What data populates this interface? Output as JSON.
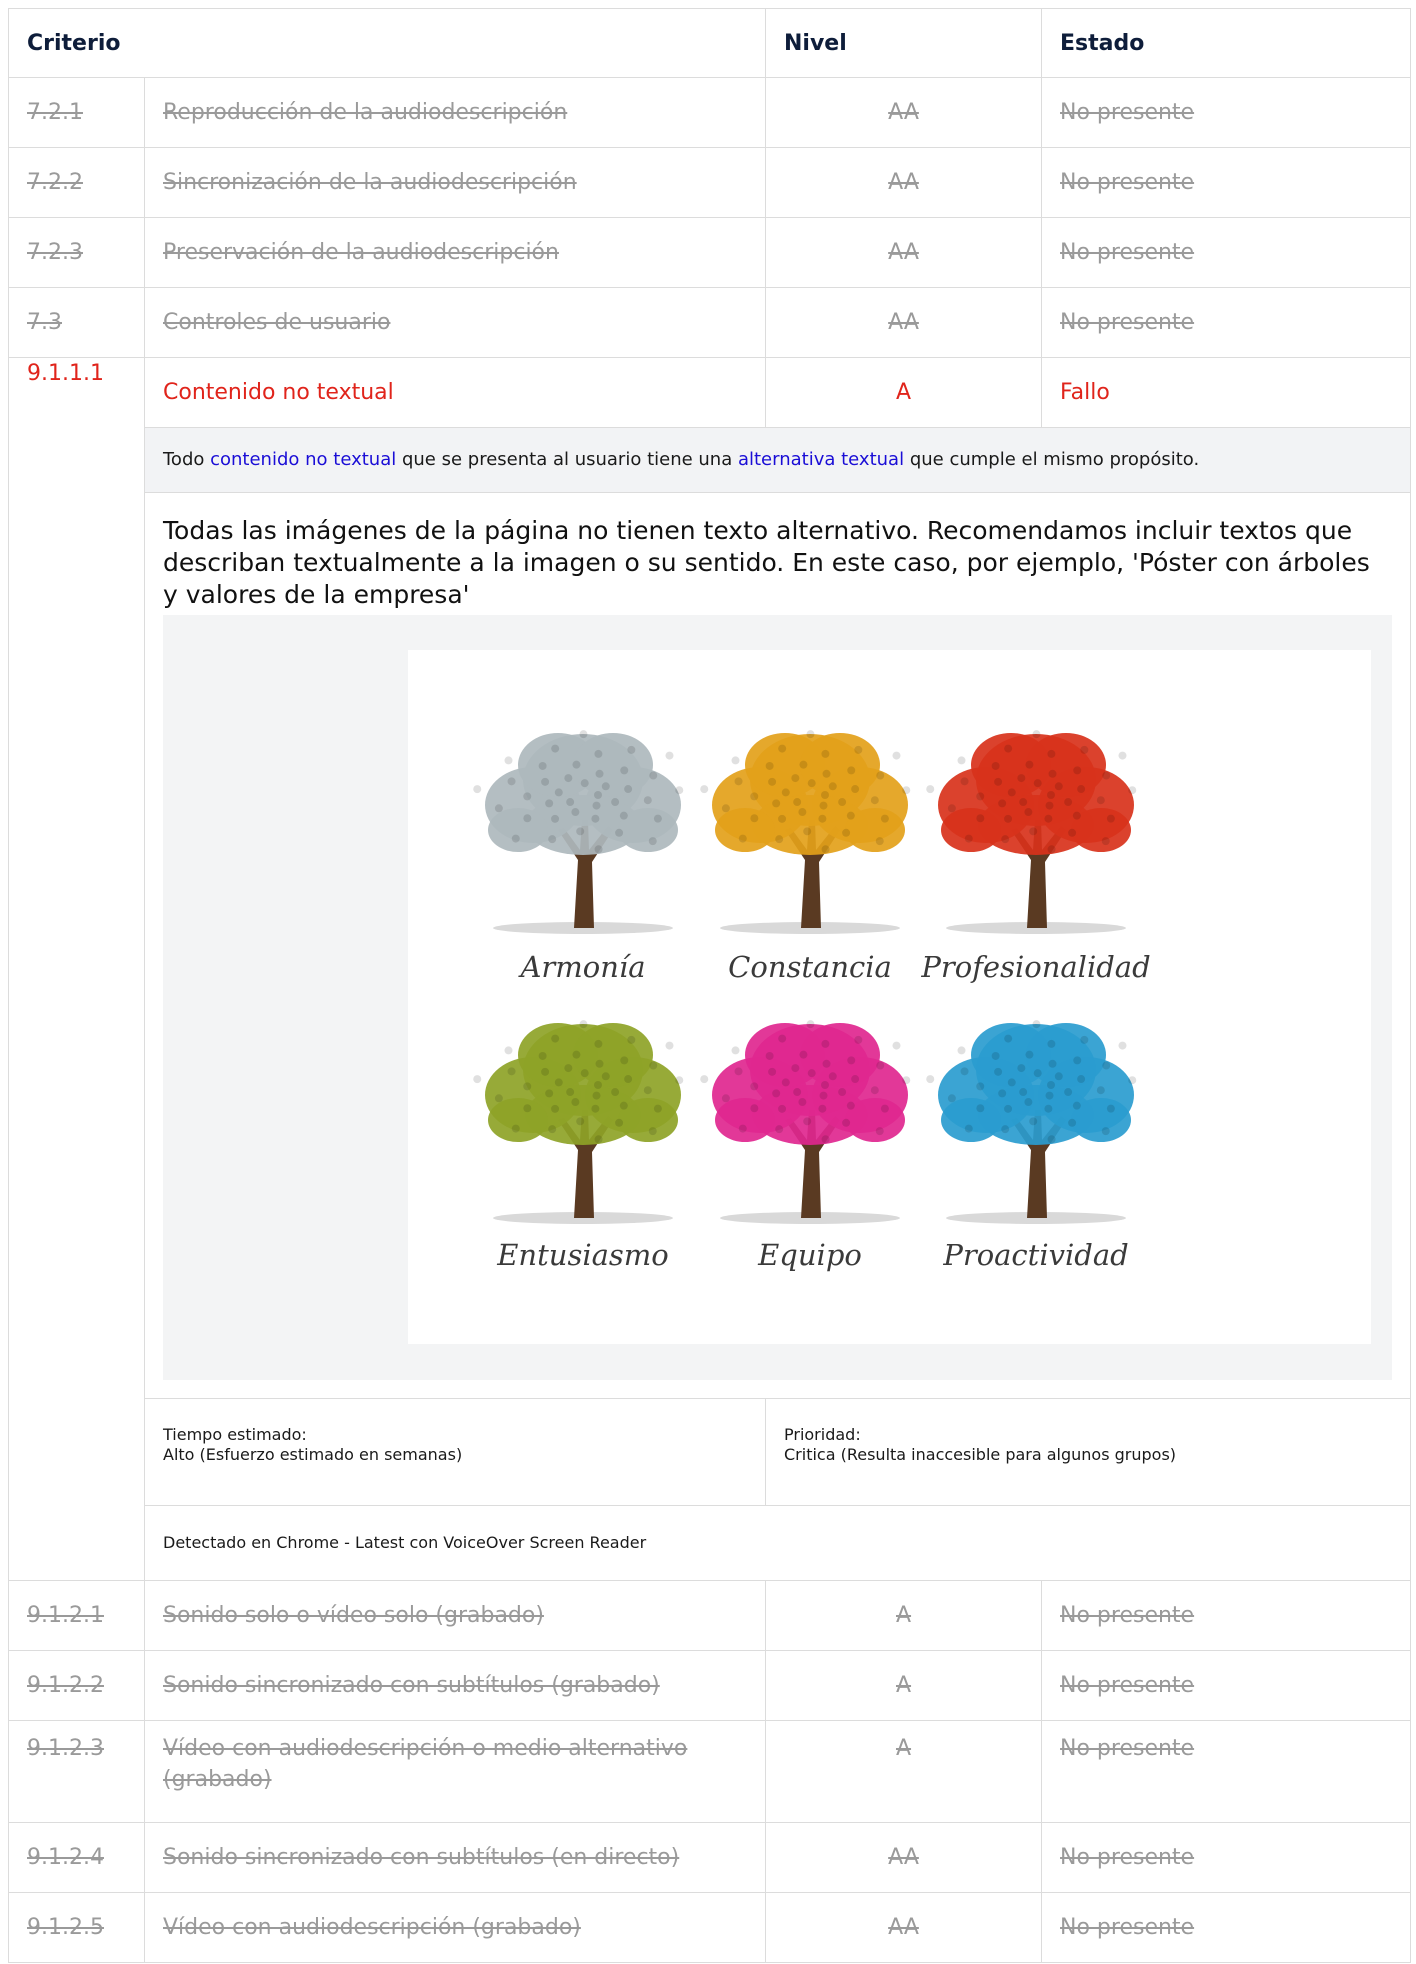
{
  "headers": {
    "criterio": "Criterio",
    "nivel": "Nivel",
    "estado": "Estado"
  },
  "rows_before": [
    {
      "code": "7.2.1",
      "name": "Reproducción de la audiodescripción",
      "level": "AA",
      "state": "No presente"
    },
    {
      "code": "7.2.2",
      "name": "Sincronización de la audiodescripción",
      "level": "AA",
      "state": "No presente"
    },
    {
      "code": "7.2.3",
      "name": "Preservación de la audiodescripción",
      "level": "AA",
      "state": "No presente"
    },
    {
      "code": "7.3",
      "name": "Controles de usuario",
      "level": "AA",
      "state": "No presente"
    }
  ],
  "fail_row": {
    "code": "9.1.1.1",
    "name": "Contenido no textual",
    "level": "A",
    "state": "Fallo",
    "definition": {
      "part1": "Todo ",
      "link1": "contenido no textual",
      "part2": " que se presenta al usuario tiene una ",
      "link2": "alternativa textual",
      "part3": " que cumple el mismo propósito."
    },
    "description": "Todas las imágenes de la página no tienen texto alternativo. Recomendamos incluir textos que describan textualmente a la imagen o su sentido. En este caso, por ejemplo, 'Póster con árboles y valores de la empresa'",
    "poster_labels": [
      "Armonía",
      "Constancia",
      "Profesionalidad",
      "Entusiasmo",
      "Equipo",
      "Proactividad"
    ],
    "poster_colors": [
      "#aeb9bd",
      "#e3a11a",
      "#d8321b",
      "#8ea327",
      "#e0278f",
      "#2a9ccf"
    ],
    "time_label": "Tiempo estimado:",
    "time_value": "Alto (Esfuerzo estimado en semanas)",
    "priority_label": "Prioridad:",
    "priority_value": "Critica (Resulta inaccesible para algunos grupos)",
    "detected": "Detectado en Chrome - Latest con VoiceOver Screen Reader"
  },
  "rows_after": [
    {
      "code": "9.1.2.1",
      "name": "Sonido solo o vídeo solo (grabado)",
      "level": "A",
      "state": "No presente"
    },
    {
      "code": "9.1.2.2",
      "name": "Sonido sincronizado con subtítulos (grabado)",
      "level": "A",
      "state": "No presente"
    },
    {
      "code": "9.1.2.3",
      "name": "Vídeo con audiodescripción o medio alternativo (grabado)",
      "level": "A",
      "state": "No presente"
    },
    {
      "code": "9.1.2.4",
      "name": "Sonido sincronizado con subtítulos (en directo)",
      "level": "AA",
      "state": "No presente"
    },
    {
      "code": "9.1.2.5",
      "name": "Vídeo con audiodescripción (grabado)",
      "level": "AA",
      "state": "No presente"
    }
  ]
}
